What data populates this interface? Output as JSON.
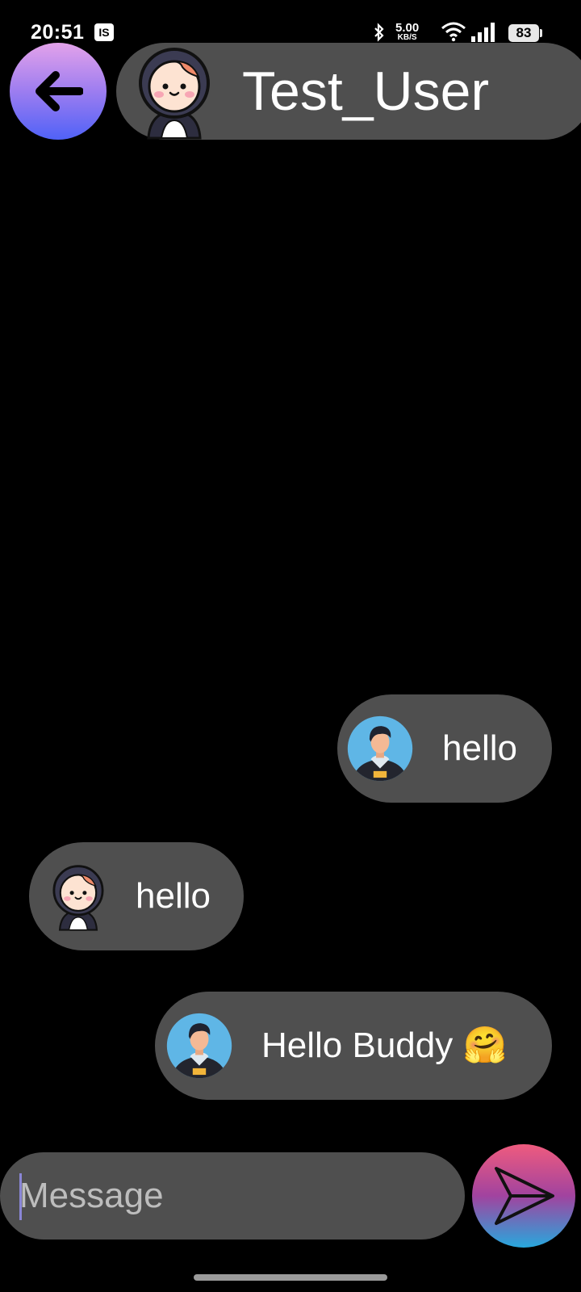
{
  "status_bar": {
    "time": "20:51",
    "ib_badge": "IS",
    "speed_value": "5.00",
    "speed_unit": "KB/S",
    "battery": "83"
  },
  "header": {
    "back_icon": "arrow-left-icon",
    "title": "Test_User",
    "avatar_icon": "hooded-kid-avatar"
  },
  "messages": [
    {
      "text": "hello",
      "direction": "sent",
      "avatar": "man-avatar"
    },
    {
      "text": "hello",
      "direction": "received",
      "avatar": "hooded-kid-avatar"
    },
    {
      "text": "Hello Buddy 🤗",
      "direction": "sent",
      "avatar": "man-avatar"
    }
  ],
  "composer": {
    "placeholder": "Message",
    "value": "",
    "send_icon": "send-icon"
  },
  "colors": {
    "background": "#000000",
    "bubble": "#4f4f4f",
    "back_gradient": [
      "#e3a2ea",
      "#5062f7"
    ],
    "send_gradient": [
      "#ef5b7e",
      "#27a8dd"
    ]
  }
}
